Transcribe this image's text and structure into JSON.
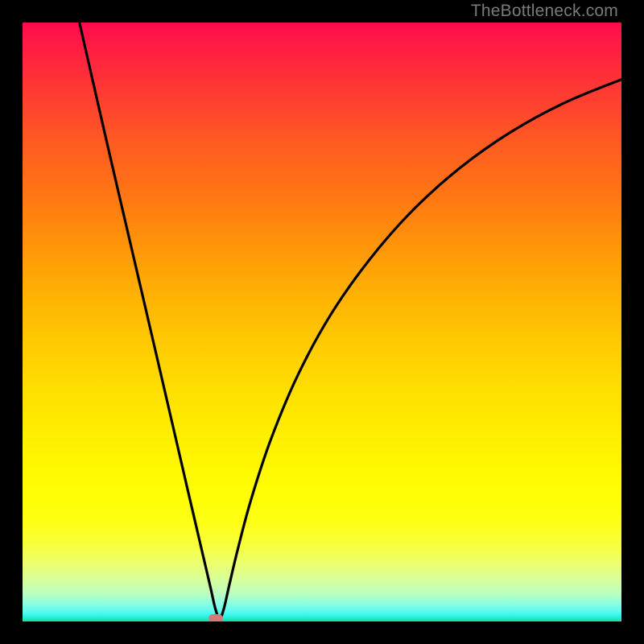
{
  "watermark": "TheBottleneck.com",
  "chart_data": {
    "type": "line",
    "title": "",
    "xlabel": "",
    "ylabel": "",
    "xlim": [
      0,
      1
    ],
    "ylim": [
      0,
      1
    ],
    "marker": {
      "x": 0.322,
      "y": 0.006,
      "color": "#d47a7a"
    },
    "series": [
      {
        "name": "curve",
        "color": "#000000",
        "points": [
          {
            "x": 0.095,
            "y": 1.0
          },
          {
            "x": 0.147,
            "y": 0.773
          },
          {
            "x": 0.2,
            "y": 0.546
          },
          {
            "x": 0.24,
            "y": 0.374
          },
          {
            "x": 0.275,
            "y": 0.223
          },
          {
            "x": 0.3,
            "y": 0.116
          },
          {
            "x": 0.314,
            "y": 0.056
          },
          {
            "x": 0.322,
            "y": 0.021
          },
          {
            "x": 0.329,
            "y": 0.005
          },
          {
            "x": 0.336,
            "y": 0.021
          },
          {
            "x": 0.345,
            "y": 0.06
          },
          {
            "x": 0.36,
            "y": 0.123
          },
          {
            "x": 0.382,
            "y": 0.205
          },
          {
            "x": 0.415,
            "y": 0.305
          },
          {
            "x": 0.46,
            "y": 0.412
          },
          {
            "x": 0.515,
            "y": 0.513
          },
          {
            "x": 0.58,
            "y": 0.605
          },
          {
            "x": 0.65,
            "y": 0.685
          },
          {
            "x": 0.73,
            "y": 0.757
          },
          {
            "x": 0.815,
            "y": 0.817
          },
          {
            "x": 0.905,
            "y": 0.866
          },
          {
            "x": 1.0,
            "y": 0.905
          }
        ]
      }
    ]
  }
}
